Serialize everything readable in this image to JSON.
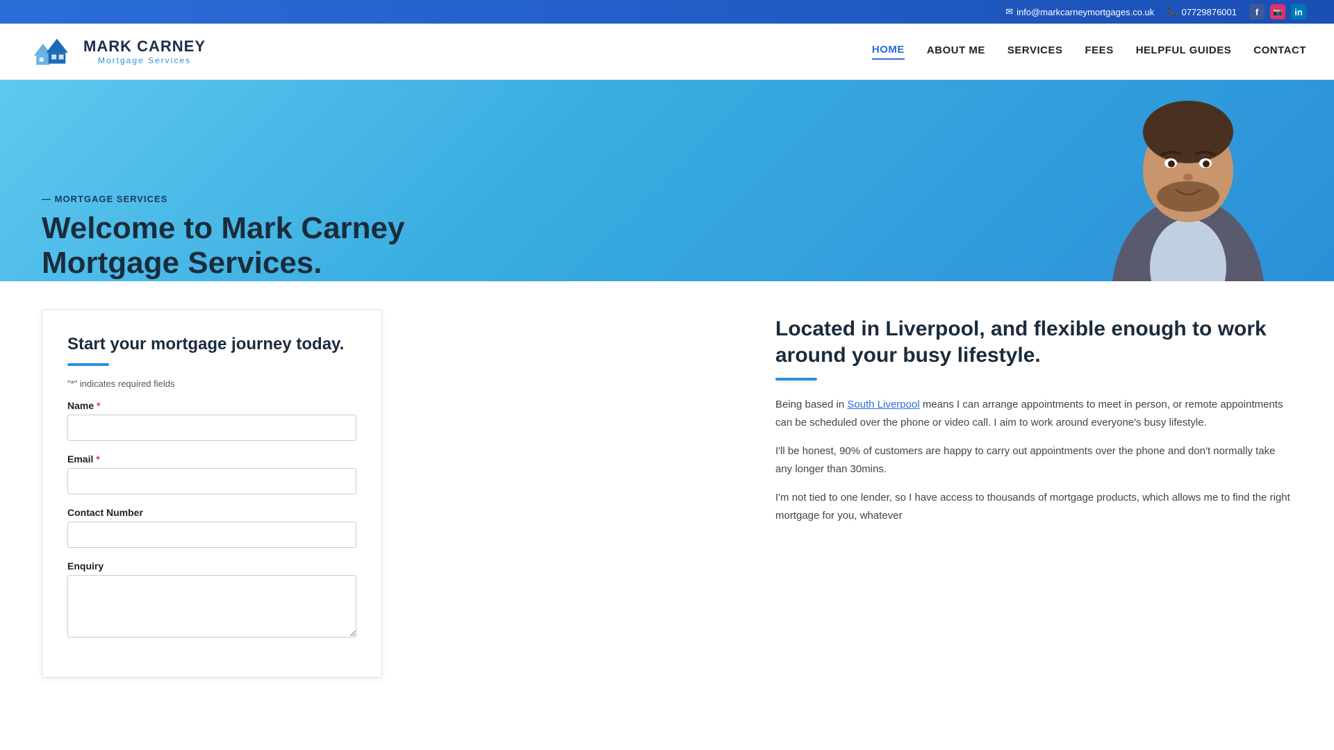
{
  "topbar": {
    "email": "info@markcarneymortgages.co.uk",
    "phone": "07729876001",
    "social": {
      "facebook_label": "f",
      "instagram_label": "In",
      "linkedin_label": "in"
    }
  },
  "logo": {
    "title_line1": "MARK CARNEY",
    "subtitle": "Mortgage Services"
  },
  "nav": {
    "items": [
      {
        "label": "HOME",
        "active": true
      },
      {
        "label": "ABOUT ME",
        "active": false
      },
      {
        "label": "SERVICES",
        "active": false
      },
      {
        "label": "FEES",
        "active": false
      },
      {
        "label": "HELPFUL GUIDES",
        "active": false
      },
      {
        "label": "CONTACT",
        "active": false
      }
    ]
  },
  "hero": {
    "subtitle": "— MORTGAGE SERVICES",
    "title_line1": "Welcome to Mark Carney",
    "title_line2": "Mortgage Services."
  },
  "form": {
    "title": "Start your mortgage journey today.",
    "required_note": "\"*\" indicates required fields",
    "fields": {
      "name_label": "Name",
      "name_placeholder": "",
      "email_label": "Email",
      "email_placeholder": "",
      "contact_label": "Contact Number",
      "contact_placeholder": "",
      "enquiry_label": "Enquiry",
      "enquiry_placeholder": ""
    }
  },
  "info": {
    "title": "Located in Liverpool, and flexible enough to work around your busy lifestyle.",
    "para1_prefix": "Being based in ",
    "para1_link": "South Liverpool",
    "para1_suffix": " means I can arrange appointments to meet in person, or remote appointments can be scheduled over the phone or video call. I aim to work around everyone's busy lifestyle.",
    "para2": "I'll be honest, 90% of customers are happy to carry out appointments over the phone and don't normally take any longer than 30mins.",
    "para3": "I'm not tied to one lender, so I have access to thousands of mortgage products, which allows me to find the right mortgage for you, whatever"
  }
}
